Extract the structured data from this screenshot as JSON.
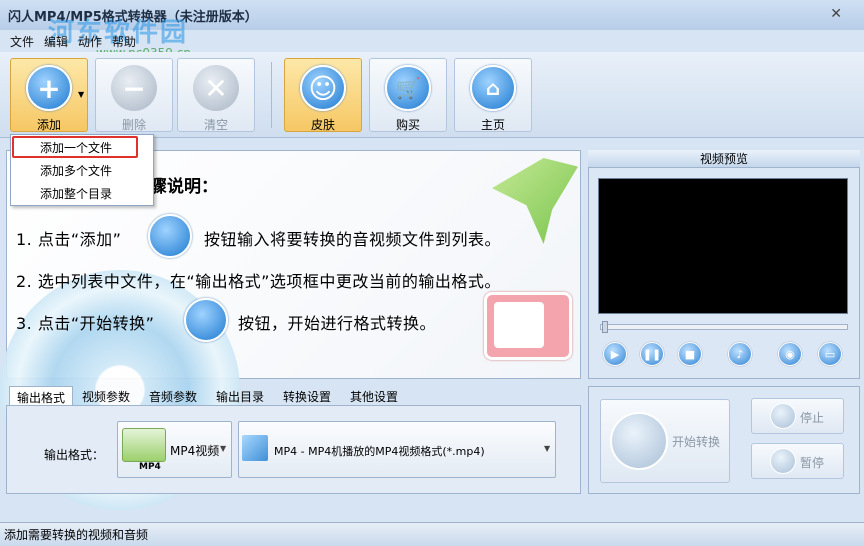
{
  "window": {
    "title": "闪人MP4/MP5格式转换器（未注册版本）",
    "watermark": "河东软件园",
    "watermark_url": "www.pc0359.cn"
  },
  "menu": [
    "文件",
    "编辑",
    "动作",
    "帮助"
  ],
  "toolbar": {
    "add": "添加",
    "delete": "删除",
    "clear": "清空",
    "skin": "皮肤",
    "buy": "购买",
    "home": "主页"
  },
  "add_menu": [
    "添加一个文件",
    "添加多个文件",
    "添加整个目录"
  ],
  "guide": {
    "heading": "骤说明：",
    "step1_a": "1. 点击“添加”",
    "step1_b": "按钮输入将要转换的音视频文件到列表。",
    "step2": "2. 选中列表中文件，在“输出格式”选项框中更改当前的输出格式。",
    "step3_a": "3. 点击“开始转换”",
    "step3_b": "按钮，开始进行格式转换。"
  },
  "preview": {
    "title": "视频预览"
  },
  "tabs": [
    "输出格式",
    "视频参数",
    "音频参数",
    "输出目录",
    "转换设置",
    "其他设置"
  ],
  "output": {
    "label": "输出格式：",
    "format": "MP4视频",
    "format_icon_label": "MP4",
    "profile": "MP4 - MP4机播放的MP4视频格式(*.mp4)"
  },
  "actions": {
    "start": "开始转换",
    "stop": "停止",
    "pause": "暂停"
  },
  "status": "添加需要转换的视频和音频"
}
